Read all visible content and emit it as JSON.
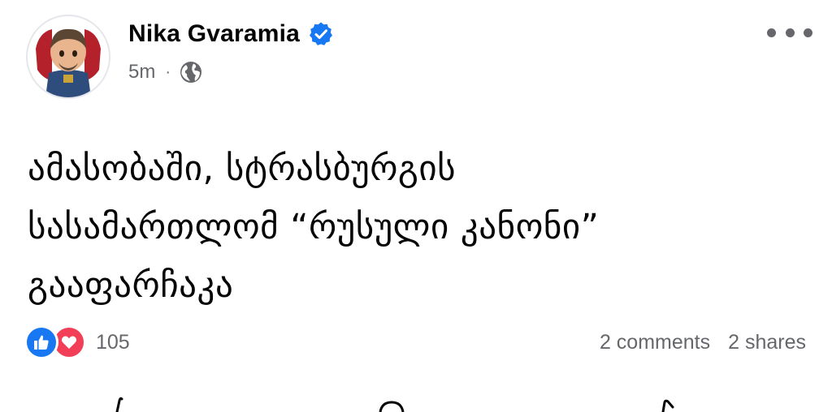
{
  "post": {
    "author": {
      "name": "Nika Gvaramia",
      "verified": true
    },
    "time": "5m",
    "separator": "·",
    "privacy_icon": "globe-icon",
    "menu_icon": "more-options-icon",
    "text_lines": [
      "ამასობაში, სტრასბურგის",
      "სასამართლომ “რუსული კანონი”",
      "გააფარჩაკა"
    ],
    "reactions": {
      "icons": [
        "like-icon",
        "love-icon"
      ],
      "count": "105"
    },
    "comments_label": "2 comments",
    "shares_label": "2 shares"
  },
  "colors": {
    "verified_blue": "#1877f2",
    "like_blue": "#1877f2",
    "love_red": "#f33e58",
    "secondary_text": "#65676b"
  }
}
